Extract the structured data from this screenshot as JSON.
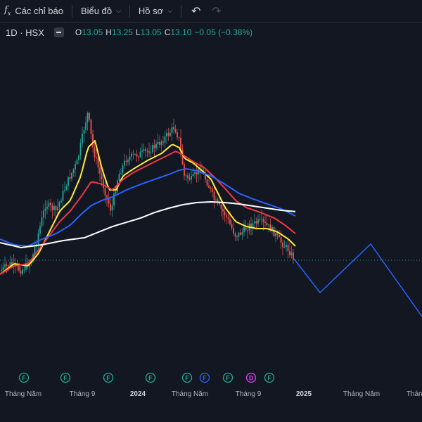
{
  "toolbar": {
    "indicators_label": "Các chỉ báo",
    "chart_type_label": "Biểu đồ",
    "profile_label": "Hồ sơ"
  },
  "legend": {
    "interval_exchange": "1D · HSX",
    "open_key": "O",
    "open_value": "13.05",
    "high_key": "H",
    "high_value": "13.25",
    "low_key": "L",
    "low_value": "13.05",
    "close_key": "C",
    "close_value": "13.10",
    "change": "−0.05 (−0.38%)"
  },
  "colors": {
    "background": "#131722",
    "up": "#26a69a",
    "down": "#ef5350",
    "ma_yellow": "#ffeb3b",
    "ma_red": "#f23645",
    "ma_blue": "#2962ff",
    "ma_white": "#ffffff",
    "projection": "#2962ff",
    "event_green": "#22ab94",
    "event_blue": "#2962ff",
    "event_purple": "#e040fb"
  },
  "chart_data": {
    "type": "candlestick",
    "x_ticks": [
      "Tháng Năm",
      "Tháng 9",
      "2024",
      "Tháng Năm",
      "Tháng 9",
      "2025",
      "Tháng Năm",
      "Tháng"
    ],
    "bold_ticks": [
      "2024",
      "2025"
    ],
    "events": [
      "F",
      "F",
      "F",
      "F",
      "F",
      "F",
      "F",
      "D",
      "F"
    ],
    "event_kinds": [
      "green",
      "green",
      "green",
      "green",
      "green",
      "blue",
      "green",
      "purple",
      "green"
    ],
    "ma_lines": [
      "yellow",
      "red",
      "blue",
      "white"
    ],
    "projection_shape": "zigzag"
  }
}
